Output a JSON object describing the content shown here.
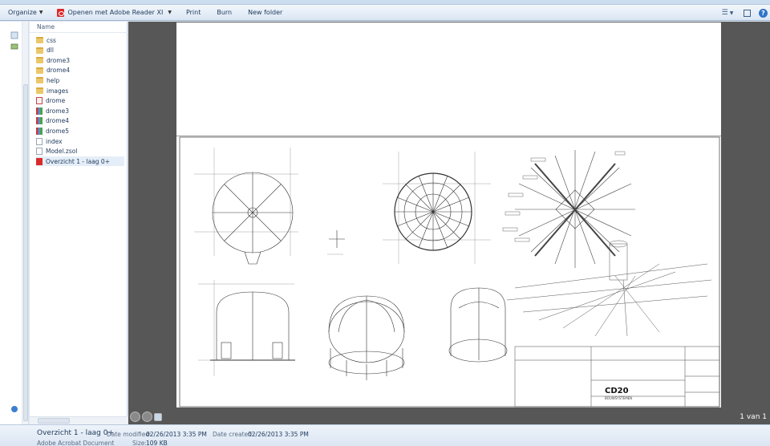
{
  "toolbar": {
    "organize": "Organize",
    "open_with": "Openen met Adobe Reader XI",
    "print": "Print",
    "burn": "Burn",
    "new_folder": "New folder"
  },
  "file_list": {
    "header": "Name",
    "items": [
      {
        "name": "css",
        "type": "folder"
      },
      {
        "name": "dll",
        "type": "folder"
      },
      {
        "name": "drome3",
        "type": "folder"
      },
      {
        "name": "drome4",
        "type": "folder"
      },
      {
        "name": "help",
        "type": "folder"
      },
      {
        "name": "images",
        "type": "folder"
      },
      {
        "name": "drome",
        "type": "icon-file"
      },
      {
        "name": "drome3",
        "type": "chm-file"
      },
      {
        "name": "drome4",
        "type": "chm-file"
      },
      {
        "name": "drome5",
        "type": "chm-file"
      },
      {
        "name": "index",
        "type": "document"
      },
      {
        "name": "Model.zsol",
        "type": "document"
      },
      {
        "name": "Overzicht 1 - laag 0+",
        "type": "pdf",
        "selected": true
      }
    ]
  },
  "preview": {
    "page_indicator": "1 van 1"
  },
  "drawing": {
    "logo": "CD20",
    "logo_sub": "BOUWSYSTEMEN"
  },
  "status": {
    "file_name": "Overzicht 1 - laag 0+",
    "file_type": "Adobe Acrobat Document",
    "date_modified_label": "Date modified:",
    "date_modified": "02/26/2013 3:35 PM",
    "date_created_label": "Date created:",
    "date_created": "02/26/2013 3:35 PM",
    "size_label": "Size:",
    "size": "109 KB"
  },
  "colors": {
    "explorer_blue": "#1e395b",
    "preview_bg": "#575757",
    "pdf_red": "#d92b2b",
    "folder_yellow": "#ecc76a"
  }
}
